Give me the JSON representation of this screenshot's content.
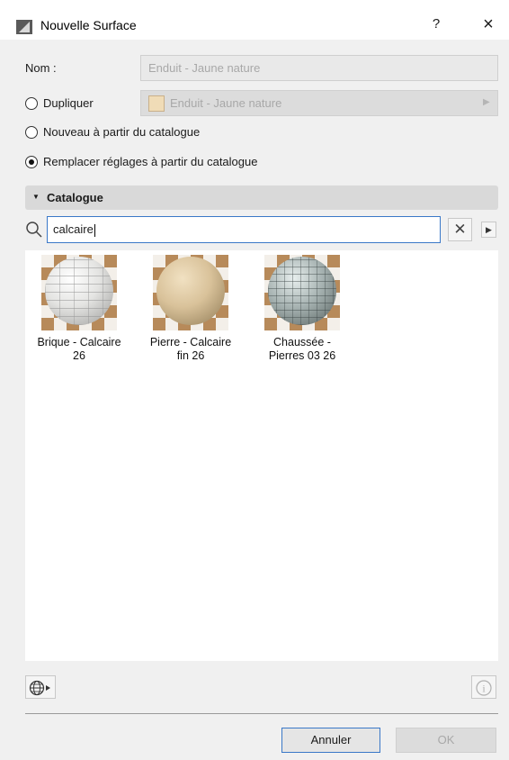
{
  "window": {
    "title": "Nouvelle Surface",
    "help": "?",
    "close": "×"
  },
  "form": {
    "nom_label": "Nom :",
    "nom_value": "Enduit - Jaune nature",
    "dupliquer_label": "Dupliquer",
    "dupliquer_value": "Enduit - Jaune nature",
    "nouveau_label": "Nouveau à partir du catalogue",
    "remplacer_label": "Remplacer réglages à partir du catalogue",
    "selected_option": "remplacer"
  },
  "catalogue": {
    "section_label": "Catalogue",
    "search_value": "calcaire",
    "items": [
      {
        "line1": "Brique - Calcaire",
        "line2": "26"
      },
      {
        "line1": "Pierre - Calcaire",
        "line2": "fin 26"
      },
      {
        "line1": "Chaussée -",
        "line2": "Pierres 03 26"
      }
    ]
  },
  "footer": {
    "cancel_label": "Annuler",
    "ok_label": "OK"
  },
  "colors": {
    "accent": "#3a78c8",
    "swatch": "#f0dcb7"
  }
}
